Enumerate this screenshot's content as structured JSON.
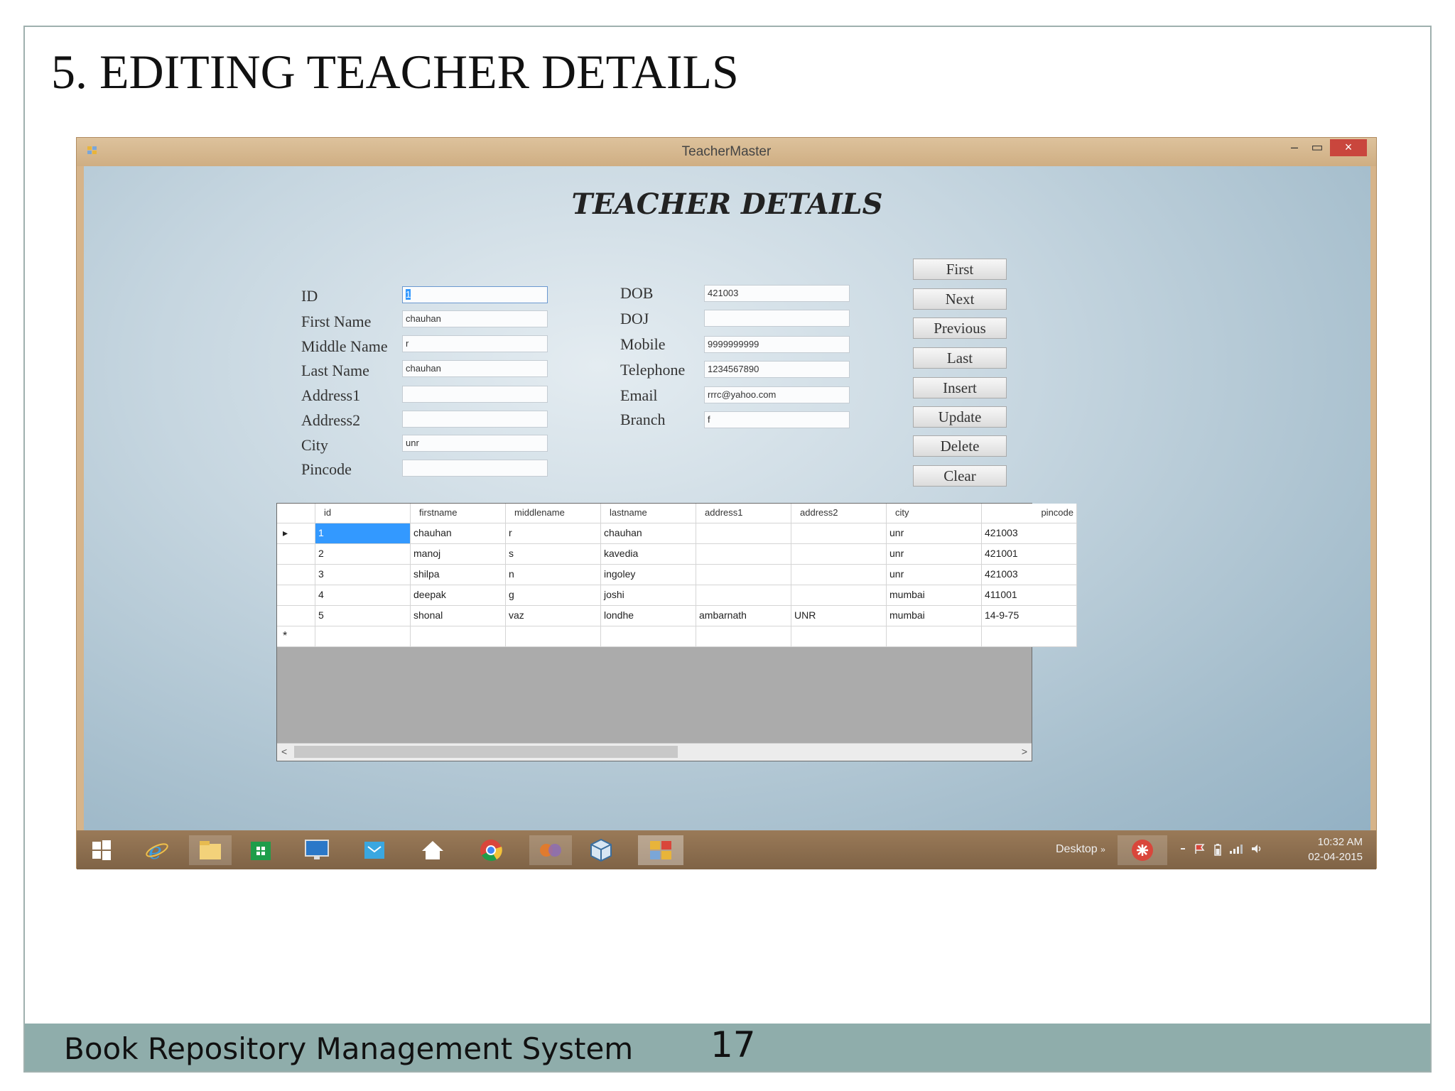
{
  "slide": {
    "title": "5. EDITING TEACHER DETAILS",
    "footer_text": "Book Repository Management System",
    "page_number": "17"
  },
  "window": {
    "title": "TeacherMaster",
    "min_label": "–",
    "max_label": "▭",
    "close_label": "×"
  },
  "form": {
    "heading": "TEACHER DETAILS",
    "left_fields": [
      {
        "label": "ID",
        "value": "1"
      },
      {
        "label": "First Name",
        "value": "chauhan"
      },
      {
        "label": "Middle Name",
        "value": "r"
      },
      {
        "label": "Last Name",
        "value": "chauhan"
      },
      {
        "label": "Address1",
        "value": ""
      },
      {
        "label": "Address2",
        "value": ""
      },
      {
        "label": "City",
        "value": "unr"
      },
      {
        "label": "Pincode",
        "value": ""
      }
    ],
    "right_fields": [
      {
        "label": "DOB",
        "value": "421003"
      },
      {
        "label": "DOJ",
        "value": ""
      },
      {
        "label": "Mobile",
        "value": "9999999999"
      },
      {
        "label": "Telephone",
        "value": "1234567890"
      },
      {
        "label": "Email",
        "value": "rrrc@yahoo.com"
      },
      {
        "label": "Branch",
        "value": "f"
      }
    ],
    "buttons": [
      "First",
      "Next",
      "Previous",
      "Last",
      "Insert",
      "Update",
      "Delete",
      "Clear"
    ]
  },
  "grid": {
    "columns": [
      "id",
      "firstname",
      "middlename",
      "lastname",
      "address1",
      "address2",
      "city",
      "pincode"
    ],
    "rows": [
      [
        "1",
        "chauhan",
        "r",
        "chauhan",
        "",
        "",
        "unr",
        "421003"
      ],
      [
        "2",
        "manoj",
        "s",
        "kavedia",
        "",
        "",
        "unr",
        "421001"
      ],
      [
        "3",
        "shilpa",
        "n",
        "ingoley",
        "",
        "",
        "unr",
        "421003"
      ],
      [
        "4",
        "deepak",
        "g",
        "joshi",
        "",
        "",
        "mumbai",
        "411001"
      ],
      [
        "5",
        "shonal",
        "vaz",
        "londhe",
        "ambarnath",
        "UNR",
        "mumbai",
        "14-9-75"
      ]
    ],
    "current_row_marker": "▸",
    "new_row_marker": "*",
    "scroll_left": "<",
    "scroll_right": ">"
  },
  "taskbar": {
    "icons": [
      "windows-start-icon",
      "internet-explorer-icon",
      "file-explorer-icon",
      "store-icon",
      "desktop-monitor-icon",
      "mail-icon",
      "home-icon",
      "chrome-icon",
      "app-icon",
      "cube-icon",
      "teachermaster-app-icon"
    ],
    "desktop_label": "Desktop",
    "tray_chevron": "»",
    "time": "10:32 AM",
    "date": "02-04-2015"
  }
}
